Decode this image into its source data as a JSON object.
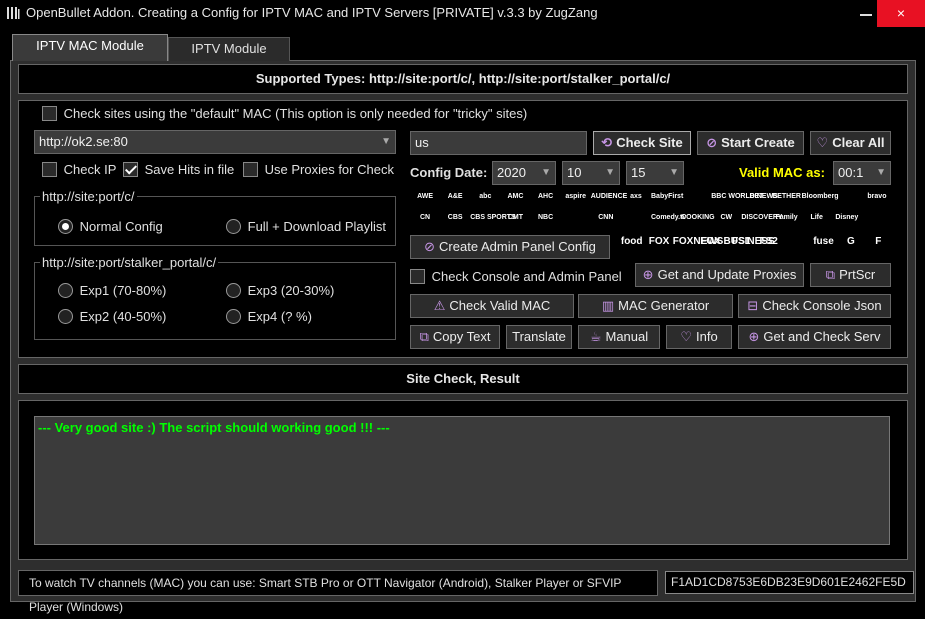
{
  "window": {
    "title": "OpenBullet Addon. Creating a Config for IPTV MAC and IPTV Servers [PRIVATE] v.3.3 by ZugZang",
    "close_glyph": "×"
  },
  "tabs": [
    {
      "label": "IPTV MAC Module",
      "active": true
    },
    {
      "label": "IPTV Module",
      "active": false
    }
  ],
  "supported_types": "Supported Types: http://site:port/c/, http://site:port/stalker_portal/c/",
  "options": {
    "default_mac_label": "Check sites using the \"default\" MAC (This option is only needed for \"tricky\" sites)",
    "default_mac_checked": false,
    "url_value": "http://ok2.se:80",
    "check_ip_label": "Check IP",
    "check_ip_checked": false,
    "save_hits_label": "Save Hits in file",
    "save_hits_checked": true,
    "use_proxies_label": "Use Proxies for Check",
    "use_proxies_checked": false
  },
  "group_c": {
    "title": "http://site:port/c/",
    "normal_label": "Normal Config",
    "full_label": "Full + Download Playlist",
    "selected": "normal"
  },
  "group_stalker": {
    "title": "http://site:port/stalker_portal/c/",
    "exp1": "Exp1 (70-80%)",
    "exp2": "Exp2 (40-50%)",
    "exp3": "Exp3 (20-30%)",
    "exp4": "Exp4 (? %)"
  },
  "right": {
    "site_value": "us",
    "check_site": "Check Site",
    "start_create": "Start Create",
    "clear_all": "Clear All",
    "config_date_label": "Config Date:",
    "year": "2020",
    "month": "10",
    "day": "15",
    "valid_mac_label": "Valid MAC as:",
    "valid_mac_value": "00:1",
    "create_admin": "Create Admin Panel Config",
    "check_console_label": "Check Console and Admin Panel",
    "check_console_checked": false,
    "get_update_proxies": "Get and Update Proxies",
    "prtscr": "PrtScr",
    "check_valid_mac": "Check Valid MAC",
    "mac_generator": "MAC Generator",
    "check_console_json": "Check Console Json",
    "copy_text": "Copy Text",
    "translate": "Translate",
    "manual": "Manual",
    "info": "Info",
    "get_check_serv": "Get and Check Serv"
  },
  "logos": {
    "row1": [
      "AWE",
      "A&E",
      "abc",
      "AMC",
      "AHC",
      "aspire",
      "AUDIENCE",
      "axs",
      "BabyFirst",
      "",
      "BBC WORLD NEWS",
      "BET",
      "BETHER",
      "Bloomberg",
      "",
      "bravo"
    ],
    "row2": [
      "CN",
      "CBS",
      "CBS SPORTS",
      "CMT",
      "NBC",
      "",
      "CNN",
      "",
      "Comedy.tv",
      "COOKING",
      "CW",
      "DISCOVERY",
      "Family",
      "Life",
      "Disney",
      ""
    ],
    "row3": [
      "food",
      "FOX",
      "FOXNEWS",
      "FOX BUSINESS",
      "FS1",
      "FS2",
      "",
      "fuse",
      "G",
      "F"
    ]
  },
  "result": {
    "heading": "Site Check, Result",
    "text": "--- Very good site :) The script should working good !!! ---"
  },
  "footer": {
    "text": "To watch TV channels (MAC) you can use: Smart STB Pro or OTT Navigator (Android), Stalker Player or SFVIP Player (Windows)",
    "hash": "F1AD1CD8753E6DB23E9D601E2462FE5D"
  },
  "colors": {
    "accent_purple": "#c796e6",
    "result_green": "#00ff00",
    "valid_mac_yellow": "#ffff00",
    "close_red": "#e81123"
  }
}
